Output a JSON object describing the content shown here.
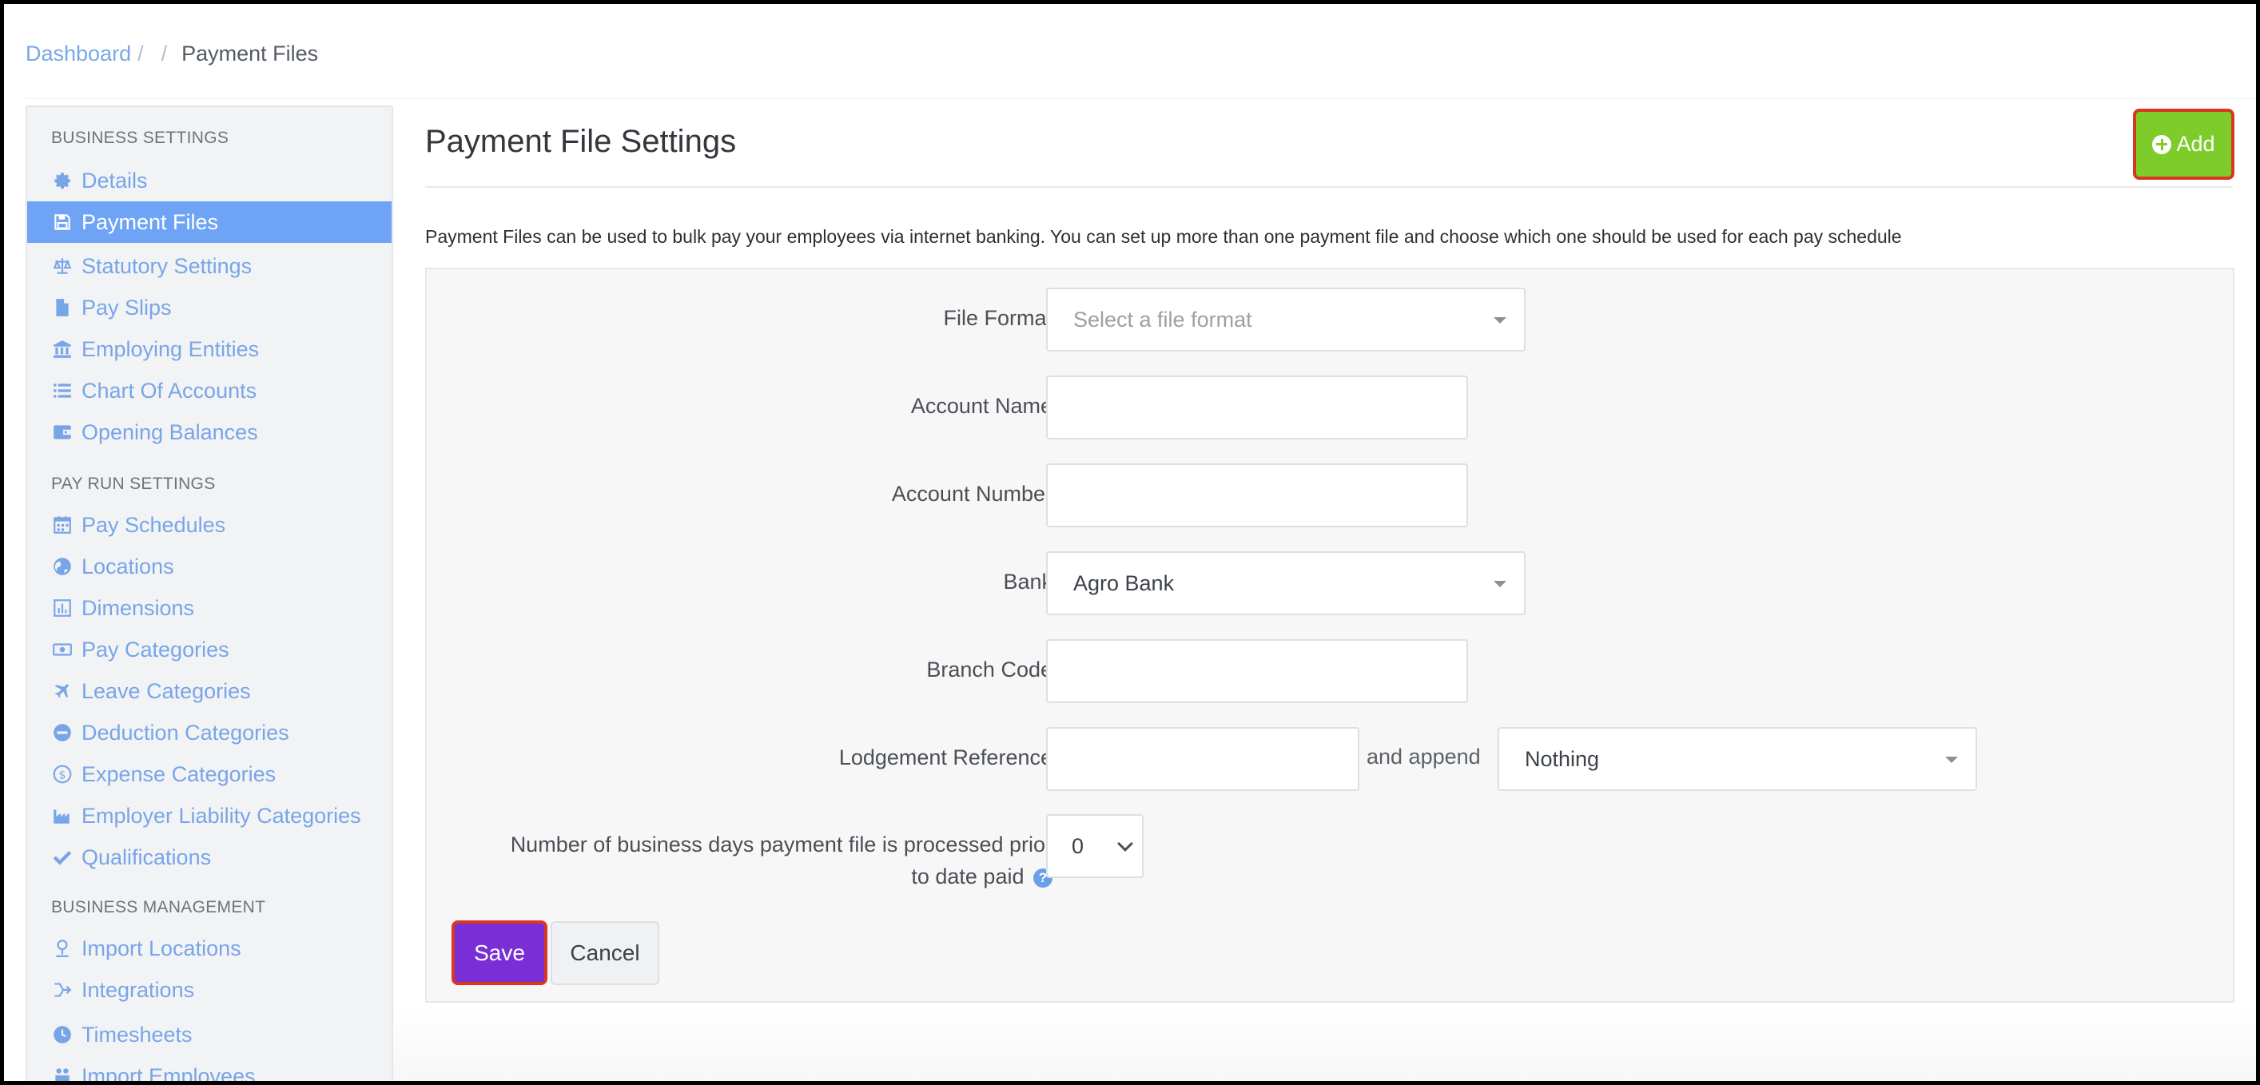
{
  "breadcrumb": {
    "root": "Dashboard",
    "separator": "/",
    "current": "Payment Files"
  },
  "sidebar": {
    "sections": [
      {
        "heading": "BUSINESS SETTINGS",
        "items": [
          {
            "label": "Details",
            "icon": "gear-icon"
          },
          {
            "label": "Payment Files",
            "icon": "floppy-disk-icon",
            "active": true
          },
          {
            "label": "Statutory Settings",
            "icon": "scale-icon"
          },
          {
            "label": "Pay Slips",
            "icon": "document-icon"
          },
          {
            "label": "Employing Entities",
            "icon": "bank-icon"
          },
          {
            "label": "Chart Of Accounts",
            "icon": "list-icon"
          },
          {
            "label": "Opening Balances",
            "icon": "wallet-icon"
          }
        ]
      },
      {
        "heading": "PAY RUN SETTINGS",
        "items": [
          {
            "label": "Pay Schedules",
            "icon": "calendar-icon"
          },
          {
            "label": "Locations",
            "icon": "globe-icon"
          },
          {
            "label": "Dimensions",
            "icon": "bar-chart-icon"
          },
          {
            "label": "Pay Categories",
            "icon": "money-icon"
          },
          {
            "label": "Leave Categories",
            "icon": "plane-icon"
          },
          {
            "label": "Deduction Categories",
            "icon": "minus-circle-icon"
          },
          {
            "label": "Expense Categories",
            "icon": "dollar-circle-icon"
          },
          {
            "label": "Employer Liability Categories",
            "icon": "industry-icon"
          },
          {
            "label": "Qualifications",
            "icon": "check-icon"
          }
        ]
      },
      {
        "heading": "BUSINESS MANAGEMENT",
        "items": [
          {
            "label": "Import Locations",
            "icon": "map-pin-icon"
          },
          {
            "label": "Integrations",
            "icon": "integrations-icon"
          },
          {
            "label": "Timesheets",
            "icon": "clock-icon"
          },
          {
            "label": "Import Employees",
            "icon": "people-icon"
          }
        ]
      }
    ]
  },
  "main": {
    "title": "Payment File Settings",
    "add_label": "Add",
    "description": "Payment Files can be used to bulk pay your employees via internet banking. You can set up more than one payment file and choose which one should be used for each pay schedule",
    "form": {
      "file_format_label": "File Format",
      "file_format_placeholder": "Select a file format",
      "account_name_label": "Account Name",
      "account_name_value": "",
      "account_number_label": "Account Number",
      "account_number_value": "",
      "bank_label": "Bank",
      "bank_value": "Agro Bank",
      "branch_code_label": "Branch Code",
      "branch_code_value": "",
      "lodgement_reference_label": "Lodgement Reference",
      "lodgement_reference_value": "",
      "and_append_label": "and append",
      "append_value": "Nothing",
      "days_prior_label_line1": "Number of business days payment file is processed prior",
      "days_prior_label_line2": "to date paid",
      "days_prior_value": "0",
      "help_glyph": "?"
    },
    "save_label": "Save",
    "cancel_label": "Cancel"
  },
  "colors": {
    "sidebar_active": "#6fa3f5",
    "link": "#78a5e8",
    "add_button": "#7dcc2a",
    "save_button": "#7a2fd6",
    "highlight_border": "#d9361f"
  }
}
